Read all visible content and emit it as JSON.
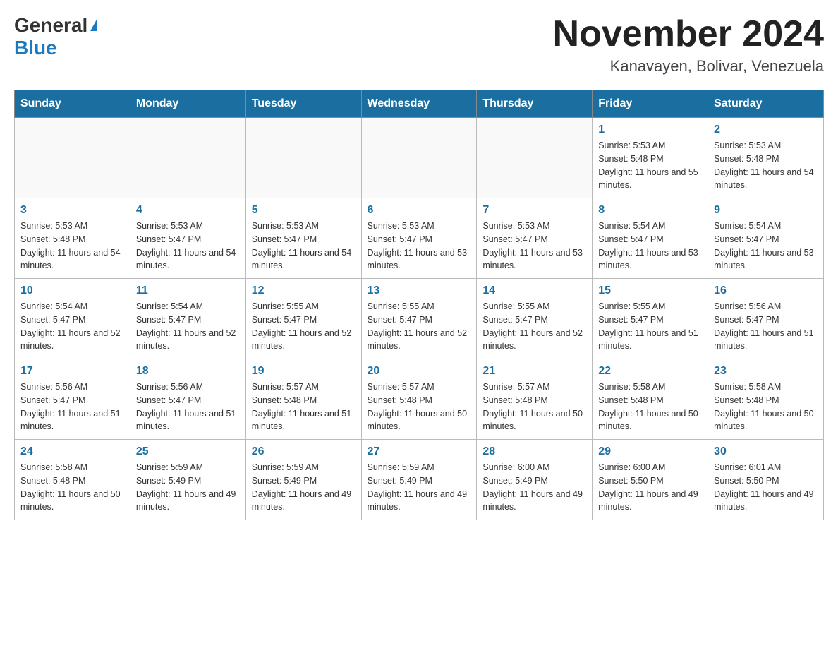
{
  "logo": {
    "general": "General",
    "blue": "Blue",
    "triangle": "▶"
  },
  "title": "November 2024",
  "subtitle": "Kanavayen, Bolivar, Venezuela",
  "days_of_week": [
    "Sunday",
    "Monday",
    "Tuesday",
    "Wednesday",
    "Thursday",
    "Friday",
    "Saturday"
  ],
  "weeks": [
    [
      {
        "day": "",
        "info": ""
      },
      {
        "day": "",
        "info": ""
      },
      {
        "day": "",
        "info": ""
      },
      {
        "day": "",
        "info": ""
      },
      {
        "day": "",
        "info": ""
      },
      {
        "day": "1",
        "info": "Sunrise: 5:53 AM\nSunset: 5:48 PM\nDaylight: 11 hours and 55 minutes."
      },
      {
        "day": "2",
        "info": "Sunrise: 5:53 AM\nSunset: 5:48 PM\nDaylight: 11 hours and 54 minutes."
      }
    ],
    [
      {
        "day": "3",
        "info": "Sunrise: 5:53 AM\nSunset: 5:48 PM\nDaylight: 11 hours and 54 minutes."
      },
      {
        "day": "4",
        "info": "Sunrise: 5:53 AM\nSunset: 5:47 PM\nDaylight: 11 hours and 54 minutes."
      },
      {
        "day": "5",
        "info": "Sunrise: 5:53 AM\nSunset: 5:47 PM\nDaylight: 11 hours and 54 minutes."
      },
      {
        "day": "6",
        "info": "Sunrise: 5:53 AM\nSunset: 5:47 PM\nDaylight: 11 hours and 53 minutes."
      },
      {
        "day": "7",
        "info": "Sunrise: 5:53 AM\nSunset: 5:47 PM\nDaylight: 11 hours and 53 minutes."
      },
      {
        "day": "8",
        "info": "Sunrise: 5:54 AM\nSunset: 5:47 PM\nDaylight: 11 hours and 53 minutes."
      },
      {
        "day": "9",
        "info": "Sunrise: 5:54 AM\nSunset: 5:47 PM\nDaylight: 11 hours and 53 minutes."
      }
    ],
    [
      {
        "day": "10",
        "info": "Sunrise: 5:54 AM\nSunset: 5:47 PM\nDaylight: 11 hours and 52 minutes."
      },
      {
        "day": "11",
        "info": "Sunrise: 5:54 AM\nSunset: 5:47 PM\nDaylight: 11 hours and 52 minutes."
      },
      {
        "day": "12",
        "info": "Sunrise: 5:55 AM\nSunset: 5:47 PM\nDaylight: 11 hours and 52 minutes."
      },
      {
        "day": "13",
        "info": "Sunrise: 5:55 AM\nSunset: 5:47 PM\nDaylight: 11 hours and 52 minutes."
      },
      {
        "day": "14",
        "info": "Sunrise: 5:55 AM\nSunset: 5:47 PM\nDaylight: 11 hours and 52 minutes."
      },
      {
        "day": "15",
        "info": "Sunrise: 5:55 AM\nSunset: 5:47 PM\nDaylight: 11 hours and 51 minutes."
      },
      {
        "day": "16",
        "info": "Sunrise: 5:56 AM\nSunset: 5:47 PM\nDaylight: 11 hours and 51 minutes."
      }
    ],
    [
      {
        "day": "17",
        "info": "Sunrise: 5:56 AM\nSunset: 5:47 PM\nDaylight: 11 hours and 51 minutes."
      },
      {
        "day": "18",
        "info": "Sunrise: 5:56 AM\nSunset: 5:47 PM\nDaylight: 11 hours and 51 minutes."
      },
      {
        "day": "19",
        "info": "Sunrise: 5:57 AM\nSunset: 5:48 PM\nDaylight: 11 hours and 51 minutes."
      },
      {
        "day": "20",
        "info": "Sunrise: 5:57 AM\nSunset: 5:48 PM\nDaylight: 11 hours and 50 minutes."
      },
      {
        "day": "21",
        "info": "Sunrise: 5:57 AM\nSunset: 5:48 PM\nDaylight: 11 hours and 50 minutes."
      },
      {
        "day": "22",
        "info": "Sunrise: 5:58 AM\nSunset: 5:48 PM\nDaylight: 11 hours and 50 minutes."
      },
      {
        "day": "23",
        "info": "Sunrise: 5:58 AM\nSunset: 5:48 PM\nDaylight: 11 hours and 50 minutes."
      }
    ],
    [
      {
        "day": "24",
        "info": "Sunrise: 5:58 AM\nSunset: 5:48 PM\nDaylight: 11 hours and 50 minutes."
      },
      {
        "day": "25",
        "info": "Sunrise: 5:59 AM\nSunset: 5:49 PM\nDaylight: 11 hours and 49 minutes."
      },
      {
        "day": "26",
        "info": "Sunrise: 5:59 AM\nSunset: 5:49 PM\nDaylight: 11 hours and 49 minutes."
      },
      {
        "day": "27",
        "info": "Sunrise: 5:59 AM\nSunset: 5:49 PM\nDaylight: 11 hours and 49 minutes."
      },
      {
        "day": "28",
        "info": "Sunrise: 6:00 AM\nSunset: 5:49 PM\nDaylight: 11 hours and 49 minutes."
      },
      {
        "day": "29",
        "info": "Sunrise: 6:00 AM\nSunset: 5:50 PM\nDaylight: 11 hours and 49 minutes."
      },
      {
        "day": "30",
        "info": "Sunrise: 6:01 AM\nSunset: 5:50 PM\nDaylight: 11 hours and 49 minutes."
      }
    ]
  ]
}
